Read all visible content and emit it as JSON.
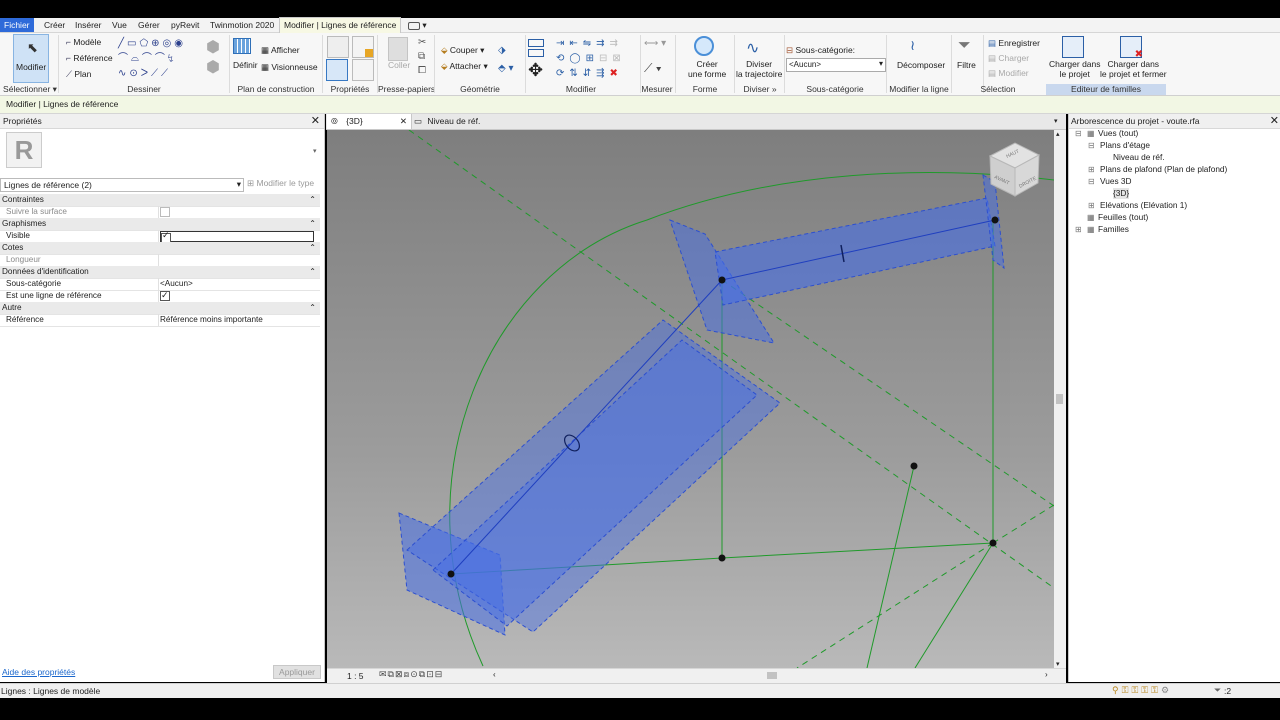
{
  "menu": {
    "file": "Fichier",
    "tabs": [
      "Créer",
      "Insérer",
      "Vue",
      "Gérer",
      "pyRevit",
      "Twinmotion 2020"
    ],
    "active_tab": "Modifier | Lignes de référence"
  },
  "ribbon": {
    "select": {
      "modify": "Modifier",
      "panel": "Sélectionner"
    },
    "draw": {
      "model": "Modèle",
      "reference": "Référence",
      "plane": "Plan",
      "panel": "Dessiner"
    },
    "work_plane": {
      "set": "Définir",
      "show": "Afficher",
      "viewer": "Visionneuse",
      "panel": "Plan de construction"
    },
    "properties_panel": "Propriétés",
    "clipboard": {
      "paste": "Coller",
      "panel": "Presse-papiers"
    },
    "geometry": {
      "cut": "Couper",
      "join": "Attacher",
      "panel": "Géométrie"
    },
    "modify_panel": "Modifier",
    "measure_panel": "Mesurer",
    "form": {
      "create_l1": "Créer",
      "create_l2": "une forme",
      "panel": "Forme"
    },
    "divide": {
      "path_l1": "Diviser",
      "path_l2": "la trajectoire",
      "panel": "Diviser"
    },
    "subcategory": {
      "label": "Sous-catégorie:",
      "value": "<Aucun>",
      "panel": "Sous-catégorie"
    },
    "modify_line": {
      "decompose": "Décomposer",
      "panel": "Modifier la ligne"
    },
    "selection": {
      "filter": "Filtre",
      "panel": "Sélection"
    },
    "family_editor": {
      "save": "Enregistrer",
      "load": "Charger",
      "modify": "Modifier",
      "load_project_l1": "Charger dans",
      "load_project_l2": "le projet",
      "load_close_l1": "Charger dans",
      "load_close_l2": "le projet et fermer",
      "panel": "Editeur de familles"
    }
  },
  "context_bar": "Modifier | Lignes de référence",
  "properties": {
    "title": "Propriétés",
    "type_selector": "Lignes de référence (2)",
    "edit_type": "Modifier le type",
    "rows": [
      {
        "kind": "cat",
        "key": "Contraintes"
      },
      {
        "kind": "row",
        "key": "Suivre la surface",
        "check": "off",
        "grey": true
      },
      {
        "kind": "cat",
        "key": "Graphismes"
      },
      {
        "kind": "row",
        "key": "Visible",
        "check": "on"
      },
      {
        "kind": "cat",
        "key": "Cotes"
      },
      {
        "kind": "row",
        "key": "Longueur",
        "grey": true
      },
      {
        "kind": "cat",
        "key": "Données d'identification"
      },
      {
        "kind": "row",
        "key": "Sous-catégorie",
        "value": "<Aucun>"
      },
      {
        "kind": "row",
        "key": "Est une ligne de référence",
        "check": "on"
      },
      {
        "kind": "cat",
        "key": "Autre"
      },
      {
        "kind": "row",
        "key": "Référence",
        "value": "Référence moins importante"
      }
    ],
    "help_link": "Aide des propriétés",
    "apply": "Appliquer"
  },
  "view_tabs": [
    {
      "label": "{3D}",
      "active": true
    },
    {
      "label": "Niveau de réf.",
      "active": false
    }
  ],
  "viewcube": {
    "top": "HAUT",
    "front": "AVANT",
    "right": "DROITE"
  },
  "view_scale": "1 : 5",
  "project_browser": {
    "title": "Arborescence du projet - voute.rfa",
    "nodes": [
      {
        "label": "Vues (tout)",
        "depth": 0,
        "toggle": "−",
        "icon": "views-icon"
      },
      {
        "label": "Plans d'étage",
        "depth": 1,
        "toggle": "−"
      },
      {
        "label": "Niveau de réf.",
        "depth": 2
      },
      {
        "label": "Plans de plafond (Plan de plafond)",
        "depth": 1,
        "toggle": "+"
      },
      {
        "label": "Vues 3D",
        "depth": 1,
        "toggle": "−"
      },
      {
        "label": "{3D}",
        "depth": 2,
        "bold": true
      },
      {
        "label": "Elévations (Elévation 1)",
        "depth": 1,
        "toggle": "+"
      },
      {
        "label": "Feuilles (tout)",
        "depth": 0,
        "icon": "sheets-icon"
      },
      {
        "label": "Familles",
        "depth": 0,
        "toggle": "+",
        "icon": "families-icon"
      }
    ]
  },
  "status": {
    "text": "Lignes : Lignes de modèle",
    "filter_count": ":2"
  }
}
